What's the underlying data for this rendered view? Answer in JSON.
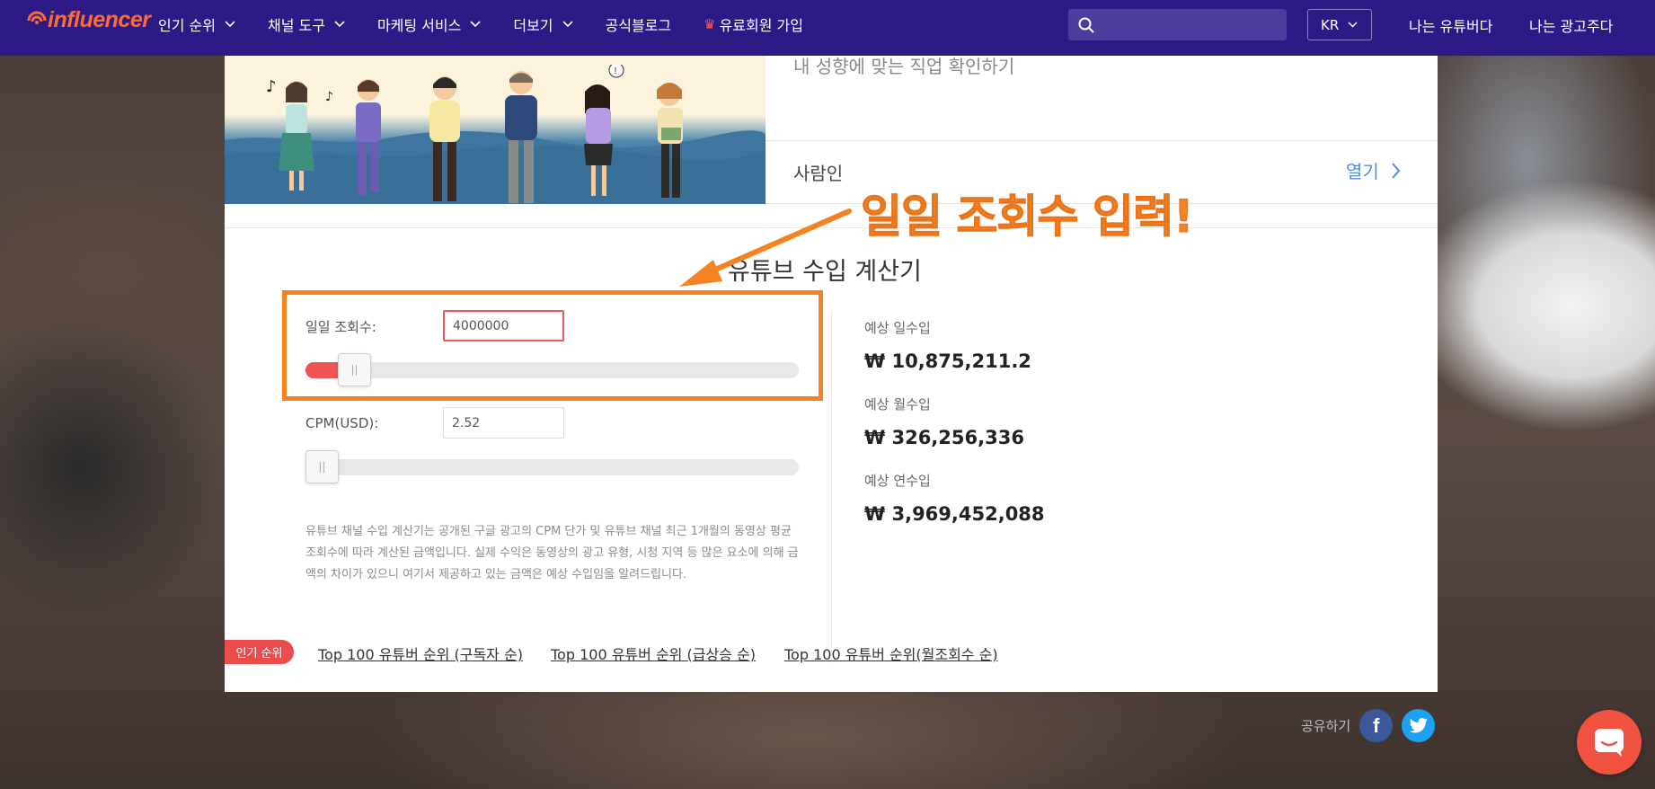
{
  "nav": {
    "logo_text": "influencer",
    "menu": [
      {
        "label": "인기 순위",
        "has_dropdown": true
      },
      {
        "label": "채널 도구",
        "has_dropdown": true
      },
      {
        "label": "마케팅 서비스",
        "has_dropdown": true
      },
      {
        "label": "더보기",
        "has_dropdown": true
      },
      {
        "label": "공식블로그",
        "has_dropdown": false
      },
      {
        "label": "유료회원 가입",
        "has_dropdown": false,
        "icon": "crown-icon"
      }
    ],
    "search_placeholder": "",
    "language": "KR",
    "youtuber_link": "나는 유튜버다",
    "advertiser_link": "나는 광고주다"
  },
  "job_info": {
    "subtitle": "내 성향에 맞는 직업 확인하기",
    "label": "사람인",
    "open_link": "열기"
  },
  "calculator": {
    "title": "유튜브 수입 계산기",
    "views_label": "일일 조회수:",
    "views_value": "4000000",
    "views_slider_percent": 7,
    "cpm_label": "CPM(USD):",
    "cpm_value": "2.52",
    "cpm_slider_percent": 0,
    "disclaimer": "유튜브 채널 수입 계산기는 공개된 구글 광고의 CPM 단가 및 유튜브 채널 최근 1개월의 동영상 평균 조회수에 따라 계산된 금액입니다. 실제 수익은 동영상의 광고 유형, 시청 지역 등 많은 요소에 의해 금액의 차이가 있으니 여기서 제공하고 있는 금액은 예상 수입임을 알려드립니다.",
    "results": [
      {
        "label": "예상 일수입",
        "value": "₩ 10,875,211.2"
      },
      {
        "label": "예상 월수입",
        "value": "₩ 326,256,336"
      },
      {
        "label": "예상 연수입",
        "value": "₩ 3,969,452,088"
      }
    ]
  },
  "rankings": {
    "badge": "인기 순위",
    "links": [
      "Top 100 유튜버 순위 (구독자 순)",
      "Top 100 유튜버 순위 (급상승 순)",
      "Top 100 유튜버 순위(월조회수 순)"
    ]
  },
  "annotation": {
    "text": "일일 조회수 입력!",
    "color": "#f58220"
  },
  "share": {
    "label": "공유하기",
    "facebook_letter": "f"
  },
  "colors": {
    "nav_bg": "#2d1a86",
    "accent_red": "#f05454",
    "link_blue": "#4a8fe7",
    "logo_orange": "#ff6b35",
    "facebook": "#3b5998",
    "twitter": "#1da1f2",
    "chat": "#f0523f"
  }
}
